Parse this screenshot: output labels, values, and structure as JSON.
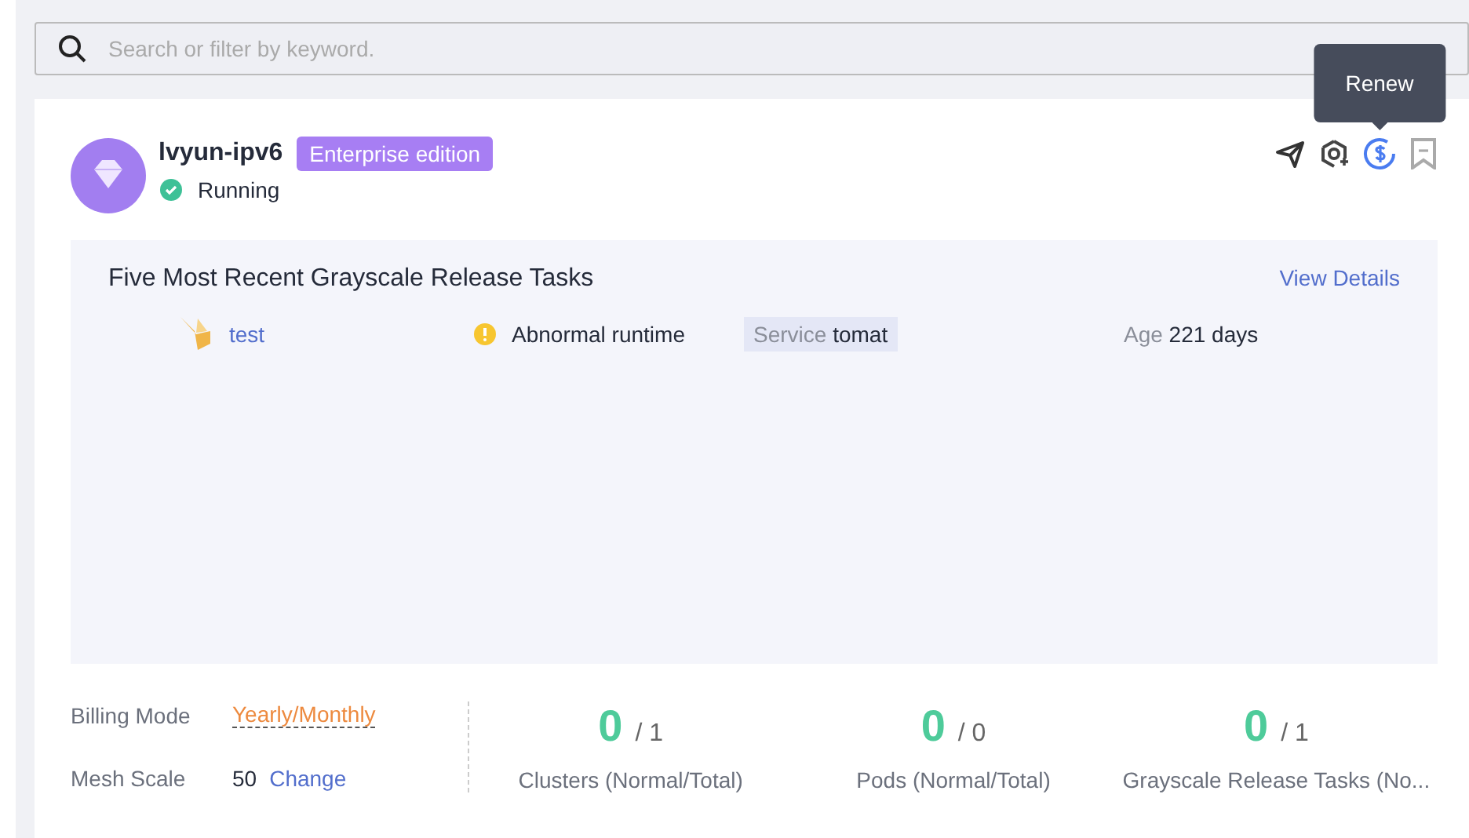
{
  "search": {
    "placeholder": "Search or filter by keyword."
  },
  "instance": {
    "name": "lvyun-ipv6",
    "edition": "Enterprise edition",
    "status": "Running",
    "kind": "ok"
  },
  "toolbar": [
    {
      "kind": "send",
      "hovered": false
    },
    {
      "kind": "hexagon",
      "hovered": false
    },
    {
      "kind": "renew",
      "hovered": true,
      "tooltip": "Renew"
    },
    {
      "kind": "bookmark",
      "hovered": false
    }
  ],
  "tasks_panel": {
    "title": "Five Most Recent Grayscale Release Tasks",
    "link": "View Details",
    "tasks": [
      {
        "name": "test",
        "status": "Abnormal runtime",
        "kind": "warning",
        "service_label": "Service",
        "service": "tomat",
        "age_label": "Age",
        "age": "221 days"
      }
    ]
  },
  "billing": [
    {
      "label": "Billing Mode",
      "value": "Yearly/Monthly",
      "kind": "dropdown"
    },
    {
      "label": "Mesh Scale",
      "value": "50",
      "link": "Change",
      "kind": "plain"
    }
  ],
  "stats": [
    {
      "normal": "0",
      "total": "/ 1",
      "label": "Clusters (Normal/Total)"
    },
    {
      "normal": "0",
      "total": "/ 0",
      "label": "Pods (Normal/Total)"
    },
    {
      "normal": "0",
      "total": "/ 1",
      "label": "Grayscale Release Tasks (No..."
    }
  ]
}
